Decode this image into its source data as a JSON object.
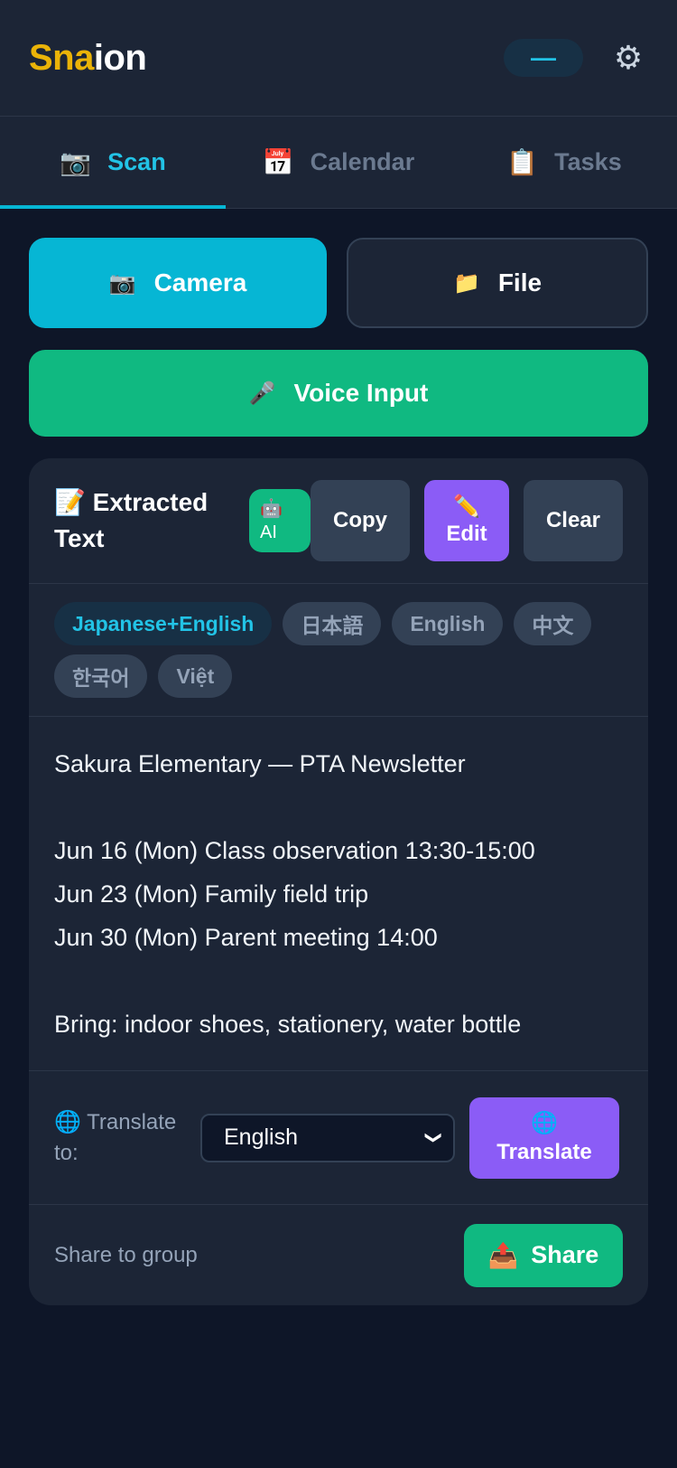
{
  "app": {
    "logo_part1": "Sna",
    "logo_part2": "ion",
    "header_pill": "—",
    "settings_icon": "gear-icon",
    "colors": {
      "accent": "#06b6d4",
      "green": "#10b981",
      "purple": "#8b5cf6",
      "logo_yellow": "#eab308"
    }
  },
  "tabs": [
    {
      "label": "Scan",
      "icon": "📷",
      "active": true
    },
    {
      "label": "Calendar",
      "icon": "📅",
      "active": false
    },
    {
      "label": "Tasks",
      "icon": "📋",
      "active": false
    }
  ],
  "input_buttons": {
    "camera_icon": "📷",
    "camera_label": "Camera",
    "file_icon": "📁",
    "file_label": "File",
    "voice_icon": "🎤",
    "voice_label": "Voice Input"
  },
  "card": {
    "title_icon": "📝",
    "title": "Extracted Text",
    "ai_icon": "🤖",
    "ai_label": "AI",
    "copy_label": "Copy",
    "edit_icon": "✏️",
    "edit_label": "Edit",
    "clear_label": "Clear"
  },
  "languages": [
    {
      "label": "Japanese+English",
      "active": true
    },
    {
      "label": "日本語",
      "active": false
    },
    {
      "label": "English",
      "active": false
    },
    {
      "label": "中文",
      "active": false
    },
    {
      "label": "한국어",
      "active": false
    },
    {
      "label": "Việt",
      "active": false
    }
  ],
  "extracted_text": {
    "line1": "Sakura Elementary — PTA Newsletter",
    "line2": "Jun 16 (Mon) Class observation 13:30-15:00",
    "line3": "Jun 23 (Mon) Family field trip",
    "line4": "Jun 30 (Mon) Parent meeting 14:00",
    "line5": "Bring: indoor shoes, stationery, water bottle"
  },
  "translate": {
    "label_icon": "🌐",
    "label": "Translate to:",
    "selected": "English",
    "button_icon": "🌐",
    "button_label": "Translate"
  },
  "share": {
    "label": "Share to group",
    "button_icon": "📤",
    "button_label": "Share"
  }
}
